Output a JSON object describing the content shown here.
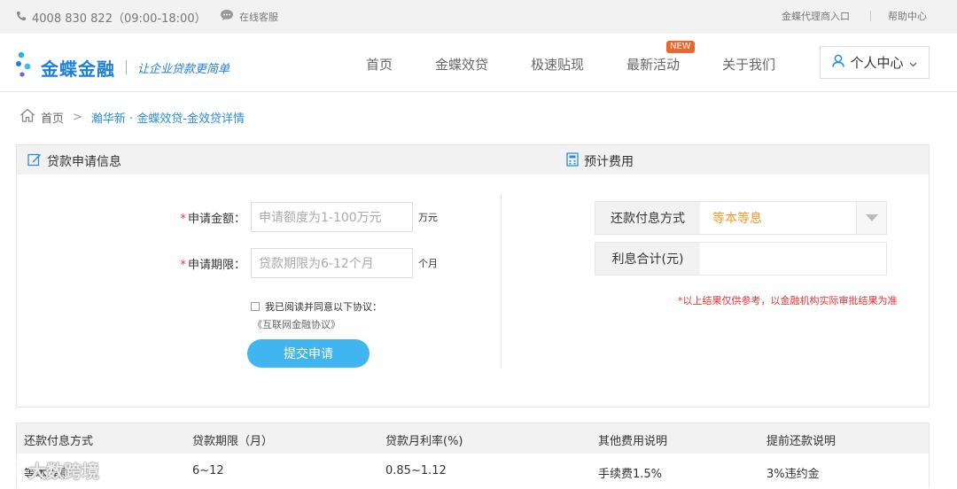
{
  "topbar": {
    "phone": "4008 830 822（09:00-18:00）",
    "service": "在线客服",
    "agent": "金蝶代理商入口",
    "help": "帮助中心"
  },
  "header": {
    "brand": "金蝶金融",
    "slogan": "让企业贷款更简单",
    "nav": [
      "首页",
      "金蝶效贷",
      "极速贴现",
      "最新活动",
      "关于我们"
    ],
    "new_badge": "NEW",
    "user_center": "个人中心"
  },
  "breadcrumb": {
    "home": "首页",
    "separator": ">",
    "current": "瀚华新 · 金蝶效贷-金效贷详情"
  },
  "apply": {
    "title": "贷款申请信息",
    "amount_label": "申请金额：",
    "amount_placeholder": "申请额度为1-100万元",
    "amount_unit": "万元",
    "term_label": "申请期限：",
    "term_placeholder": "贷款期限为6-12个月",
    "term_unit": "个月",
    "required_mark": "*",
    "agree_text": "我已阅读并同意以下协议：",
    "protocol": "《互联网金融协议》",
    "submit": "提交申请"
  },
  "fee": {
    "title": "预计费用",
    "method_label": "还款付息方式",
    "method_value": "等本等息",
    "interest_label": "利息合计(元)",
    "interest_value": "",
    "note": "*以上结果仅供参考，以金融机构实际审批结果为准"
  },
  "table": {
    "headers": [
      "还款付息方式",
      "贷款期限（月）",
      "贷款月利率(%)",
      "其他费用说明",
      "提前还款说明"
    ],
    "row": [
      "等本等息",
      "6~12",
      "0.85~1.12",
      "手续费1.5%",
      "3%违约金"
    ]
  },
  "watermark": "大数跨境",
  "colors": {
    "brand": "#1e7fd8",
    "accent": "#40b5f0",
    "orange": "#f29a2e",
    "required": "#e33333"
  }
}
